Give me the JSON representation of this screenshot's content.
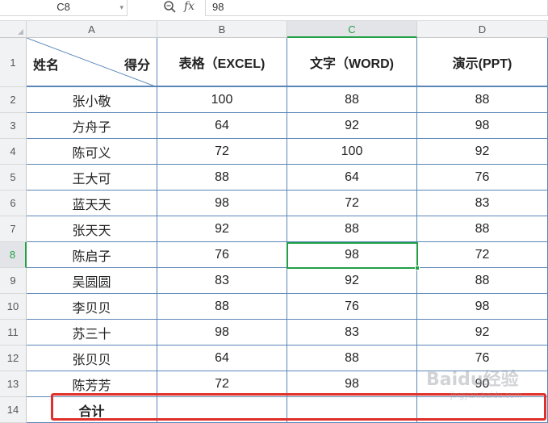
{
  "formula_bar": {
    "cell_ref": "C8",
    "fx_label": "fx",
    "value": "98"
  },
  "columns": [
    "A",
    "B",
    "C",
    "D"
  ],
  "selected_column": "C",
  "selected_row": "8",
  "rows": [
    "1",
    "2",
    "3",
    "4",
    "5",
    "6",
    "7",
    "8",
    "9",
    "10",
    "11",
    "12",
    "13",
    "14"
  ],
  "header": {
    "diag_left": "姓名",
    "diag_right": "得分",
    "b": "表格（EXCEL)",
    "c": "文字（WORD)",
    "d": "演示(PPT)"
  },
  "table": [
    {
      "name": "张小敬",
      "b": "100",
      "c": "88",
      "d": "88"
    },
    {
      "name": "方舟子",
      "b": "64",
      "c": "92",
      "d": "98"
    },
    {
      "name": "陈可义",
      "b": "72",
      "c": "100",
      "d": "92"
    },
    {
      "name": "王大可",
      "b": "88",
      "c": "64",
      "d": "76"
    },
    {
      "name": "蓝天天",
      "b": "98",
      "c": "72",
      "d": "83"
    },
    {
      "name": "张天天",
      "b": "92",
      "c": "88",
      "d": "88"
    },
    {
      "name": "陈启子",
      "b": "76",
      "c": "98",
      "d": "72"
    },
    {
      "name": "吴圆圆",
      "b": "83",
      "c": "92",
      "d": "88"
    },
    {
      "name": "李贝贝",
      "b": "88",
      "c": "76",
      "d": "98"
    },
    {
      "name": "苏三十",
      "b": "98",
      "c": "83",
      "d": "92"
    },
    {
      "name": "张贝贝",
      "b": "64",
      "c": "88",
      "d": "76"
    },
    {
      "name": "陈芳芳",
      "b": "72",
      "c": "98",
      "d": "90"
    }
  ],
  "total_row": {
    "label": "合计",
    "b": "",
    "c": "",
    "d": ""
  },
  "watermark": {
    "line1": "Baidu经验",
    "line2": "jingyan.baidu.com"
  },
  "colors": {
    "selection": "#21a046",
    "grid": "#5b86b8",
    "highlight": "#e0302a"
  }
}
